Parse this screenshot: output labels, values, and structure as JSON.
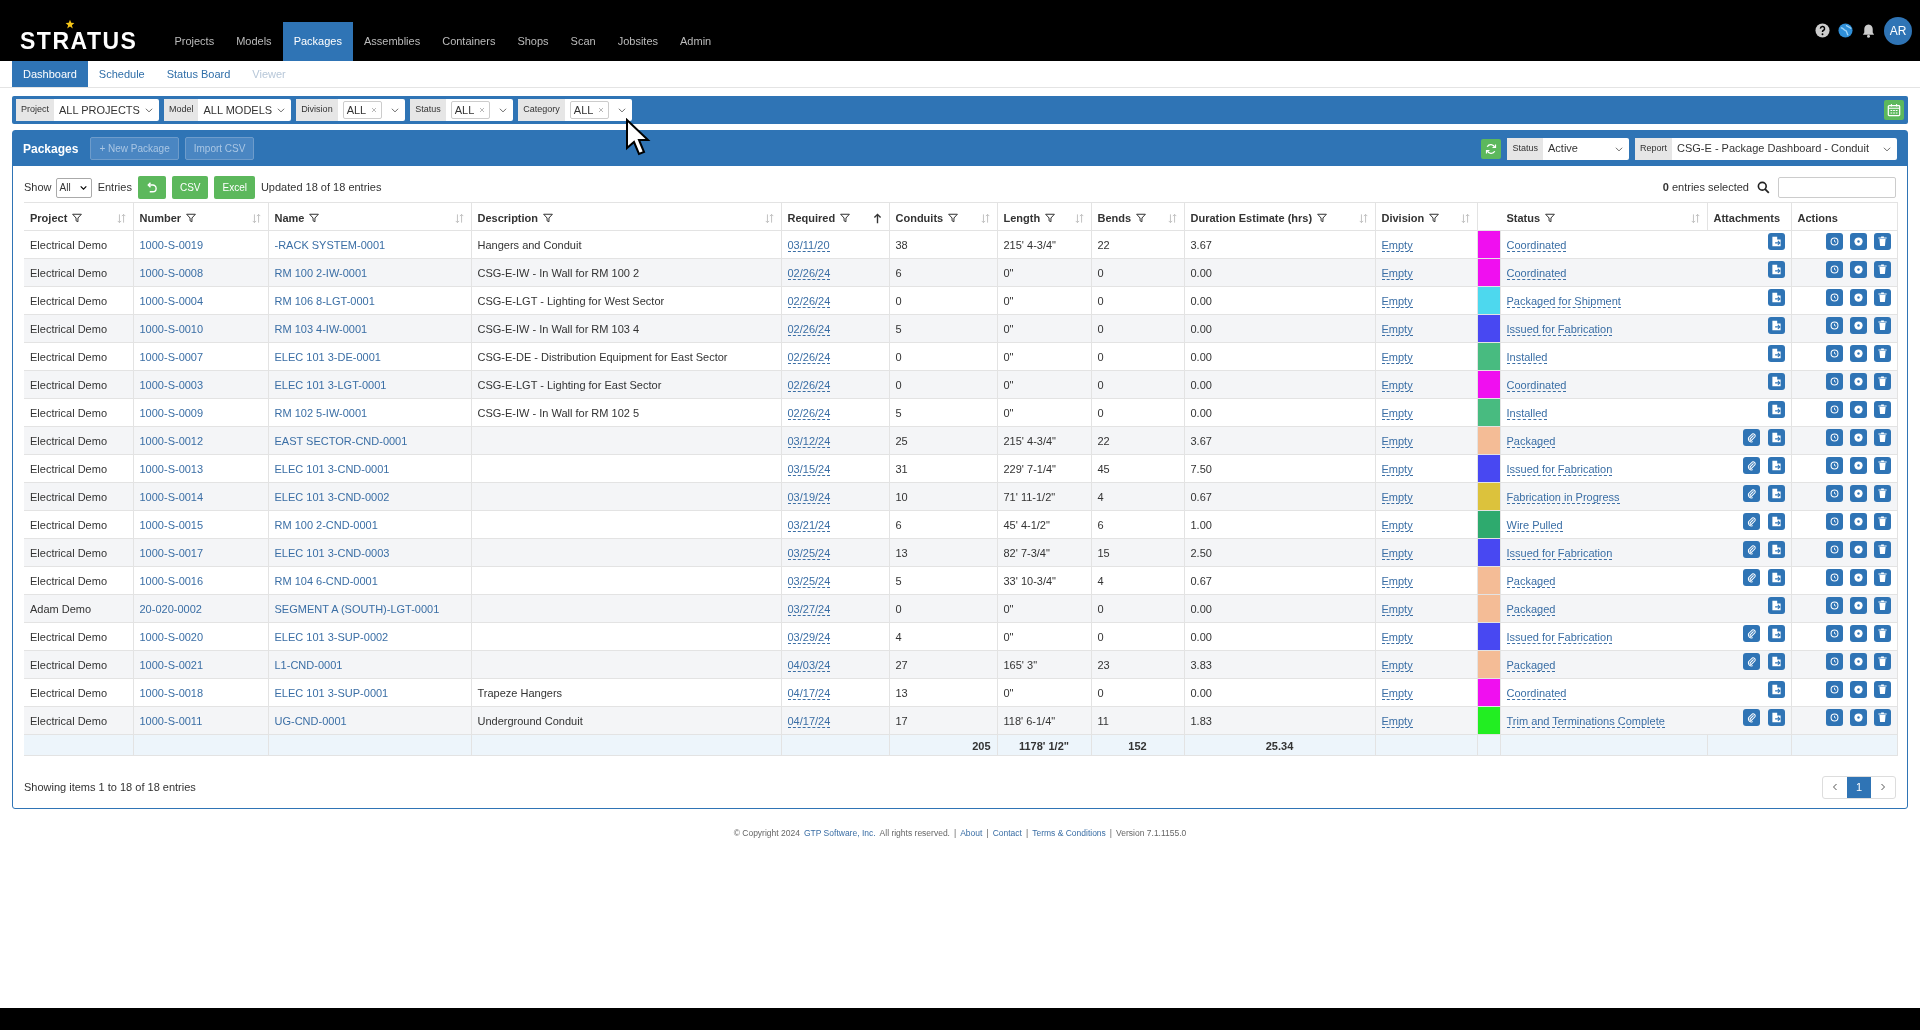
{
  "logo": "STRATUS",
  "nav": [
    {
      "label": "Projects",
      "selected": false
    },
    {
      "label": "Models",
      "selected": false
    },
    {
      "label": "Packages",
      "selected": true
    },
    {
      "label": "Assemblies",
      "selected": false
    },
    {
      "label": "Containers",
      "selected": false
    },
    {
      "label": "Shops",
      "selected": false
    },
    {
      "label": "Scan",
      "selected": false
    },
    {
      "label": "Jobsites",
      "selected": false
    },
    {
      "label": "Admin",
      "selected": false
    }
  ],
  "user": {
    "initials": "AR"
  },
  "subnav": [
    {
      "label": "Dashboard",
      "selected": true,
      "disabled": false
    },
    {
      "label": "Schedule",
      "selected": false,
      "disabled": false
    },
    {
      "label": "Status Board",
      "selected": false,
      "disabled": false
    },
    {
      "label": "Viewer",
      "selected": false,
      "disabled": true
    }
  ],
  "filters": [
    {
      "label": "Project",
      "value": "ALL PROJECTS",
      "clearable": false
    },
    {
      "label": "Model",
      "value": "ALL MODELS",
      "clearable": false
    },
    {
      "label": "Division",
      "value": "ALL",
      "clearable": true
    },
    {
      "label": "Status",
      "value": "ALL",
      "clearable": true
    },
    {
      "label": "Category",
      "value": "ALL",
      "clearable": true
    }
  ],
  "panel": {
    "title": "Packages",
    "buttons": [
      "+ New Package",
      "Import CSV"
    ],
    "status_filter": {
      "label": "Status",
      "value": "Active"
    },
    "report": {
      "label": "Report",
      "value": "CSG-E - Package Dashboard - Conduit"
    }
  },
  "toolbar": {
    "show_label": "Show",
    "show_value": "All",
    "entries_label": "Entries",
    "export_buttons": [
      "CSV",
      "Excel"
    ],
    "updated": "Updated 18 of 18 entries",
    "selected_count": "0",
    "selected_label": "entries selected"
  },
  "table": {
    "columns": [
      {
        "label": "Project",
        "filter": true,
        "sorted_ascending": false
      },
      {
        "label": "Number",
        "filter": true,
        "sorted_ascending": false
      },
      {
        "label": "Name",
        "filter": true,
        "sorted_ascending": false
      },
      {
        "label": "Description",
        "filter": true,
        "sorted_ascending": false
      },
      {
        "label": "Required",
        "filter": true,
        "sorted_ascending": true
      },
      {
        "label": "Conduits",
        "filter": true,
        "sorted_ascending": false
      },
      {
        "label": "Length",
        "filter": true,
        "sorted_ascending": false
      },
      {
        "label": "Bends",
        "filter": true,
        "sorted_ascending": false
      },
      {
        "label": "Duration Estimate (hrs)",
        "filter": true,
        "sorted_ascending": false
      },
      {
        "label": "Division",
        "filter": true,
        "sorted_ascending": false
      },
      {
        "label": "Status",
        "filter": true,
        "sorted_ascending": false
      },
      {
        "label": "Attachments",
        "filter": false
      },
      {
        "label": "Actions",
        "filter": false
      }
    ],
    "rows": [
      {
        "project": "Electrical Demo",
        "number": "1000-S-0019",
        "name": "-RACK SYSTEM-0001",
        "description": "Hangers and Conduit",
        "required": "03/11/20",
        "conduits": "38",
        "length": "215' 4-3/4\"",
        "bends": "22",
        "duration": "3.67",
        "division": "Empty",
        "color": "#f00ff0",
        "status": "Coordinated",
        "clip": false
      },
      {
        "project": "Electrical Demo",
        "number": "1000-S-0008",
        "name": "RM 100 2-IW-0001",
        "description": "CSG-E-IW - In Wall for RM 100 2",
        "required": "02/26/24",
        "conduits": "6",
        "length": "0\"",
        "bends": "0",
        "duration": "0.00",
        "division": "Empty",
        "color": "#f00ff0",
        "status": "Coordinated",
        "clip": false
      },
      {
        "project": "Electrical Demo",
        "number": "1000-S-0004",
        "name": "RM 106 8-LGT-0001",
        "description": "CSG-E-LGT - Lighting for West Sector",
        "required": "02/26/24",
        "conduits": "0",
        "length": "0\"",
        "bends": "0",
        "duration": "0.00",
        "division": "Empty",
        "color": "#4dd8ee",
        "status": "Packaged for Shipment",
        "clip": false
      },
      {
        "project": "Electrical Demo",
        "number": "1000-S-0010",
        "name": "RM 103 4-IW-0001",
        "description": "CSG-E-IW - In Wall for RM 103 4",
        "required": "02/26/24",
        "conduits": "5",
        "length": "0\"",
        "bends": "0",
        "duration": "0.00",
        "division": "Empty",
        "color": "#4848f2",
        "status": "Issued for Fabrication",
        "clip": false
      },
      {
        "project": "Electrical Demo",
        "number": "1000-S-0007",
        "name": "ELEC 101 3-DE-0001",
        "description": "CSG-E-DE - Distribution Equipment for East Sector",
        "required": "02/26/24",
        "conduits": "0",
        "length": "0\"",
        "bends": "0",
        "duration": "0.00",
        "division": "Empty",
        "color": "#48bb80",
        "status": "Installed",
        "clip": false
      },
      {
        "project": "Electrical Demo",
        "number": "1000-S-0003",
        "name": "ELEC 101 3-LGT-0001",
        "description": "CSG-E-LGT - Lighting for East Sector",
        "required": "02/26/24",
        "conduits": "0",
        "length": "0\"",
        "bends": "0",
        "duration": "0.00",
        "division": "Empty",
        "color": "#f00ff0",
        "status": "Coordinated",
        "clip": false
      },
      {
        "project": "Electrical Demo",
        "number": "1000-S-0009",
        "name": "RM 102 5-IW-0001",
        "description": "CSG-E-IW - In Wall for RM 102 5",
        "required": "02/26/24",
        "conduits": "5",
        "length": "0\"",
        "bends": "0",
        "duration": "0.00",
        "division": "Empty",
        "color": "#48bb80",
        "status": "Installed",
        "clip": false
      },
      {
        "project": "Electrical Demo",
        "number": "1000-S-0012",
        "name": "EAST SECTOR-CND-0001",
        "description": "",
        "required": "03/12/24",
        "conduits": "25",
        "length": "215' 4-3/4\"",
        "bends": "22",
        "duration": "3.67",
        "division": "Empty",
        "color": "#f4bc96",
        "status": "Packaged",
        "clip": true
      },
      {
        "project": "Electrical Demo",
        "number": "1000-S-0013",
        "name": "ELEC 101 3-CND-0001",
        "description": "",
        "required": "03/15/24",
        "conduits": "31",
        "length": "229' 7-1/4\"",
        "bends": "45",
        "duration": "7.50",
        "division": "Empty",
        "color": "#4848f2",
        "status": "Issued for Fabrication",
        "clip": true
      },
      {
        "project": "Electrical Demo",
        "number": "1000-S-0014",
        "name": "ELEC 101 3-CND-0002",
        "description": "",
        "required": "03/19/24",
        "conduits": "10",
        "length": "71' 11-1/2\"",
        "bends": "4",
        "duration": "0.67",
        "division": "Empty",
        "color": "#dcc23c",
        "status": "Fabrication in Progress",
        "clip": true
      },
      {
        "project": "Electrical Demo",
        "number": "1000-S-0015",
        "name": "RM 100 2-CND-0001",
        "description": "",
        "required": "03/21/24",
        "conduits": "6",
        "length": "45' 4-1/2\"",
        "bends": "6",
        "duration": "1.00",
        "division": "Empty",
        "color": "#2eaa6e",
        "status": "Wire Pulled",
        "clip": true
      },
      {
        "project": "Electrical Demo",
        "number": "1000-S-0017",
        "name": "ELEC 101 3-CND-0003",
        "description": "",
        "required": "03/25/24",
        "conduits": "13",
        "length": "82' 7-3/4\"",
        "bends": "15",
        "duration": "2.50",
        "division": "Empty",
        "color": "#4848f2",
        "status": "Issued for Fabrication",
        "clip": true
      },
      {
        "project": "Electrical Demo",
        "number": "1000-S-0016",
        "name": "RM 104 6-CND-0001",
        "description": "",
        "required": "03/25/24",
        "conduits": "5",
        "length": "33' 10-3/4\"",
        "bends": "4",
        "duration": "0.67",
        "division": "Empty",
        "color": "#f4bc96",
        "status": "Packaged",
        "clip": true
      },
      {
        "project": "Adam Demo",
        "number": "20-020-0002",
        "name": "SEGMENT A (SOUTH)-LGT-0001",
        "description": "",
        "required": "03/27/24",
        "conduits": "0",
        "length": "0\"",
        "bends": "0",
        "duration": "0.00",
        "division": "Empty",
        "color": "#f4bc96",
        "status": "Packaged",
        "clip": false
      },
      {
        "project": "Electrical Demo",
        "number": "1000-S-0020",
        "name": "ELEC 101 3-SUP-0002",
        "description": "",
        "required": "03/29/24",
        "conduits": "4",
        "length": "0\"",
        "bends": "0",
        "duration": "0.00",
        "division": "Empty",
        "color": "#4848f2",
        "status": "Issued for Fabrication",
        "clip": true
      },
      {
        "project": "Electrical Demo",
        "number": "1000-S-0021",
        "name": "L1-CND-0001",
        "description": "",
        "required": "04/03/24",
        "conduits": "27",
        "length": "165' 3\"",
        "bends": "23",
        "duration": "3.83",
        "division": "Empty",
        "color": "#f4bc96",
        "status": "Packaged",
        "clip": true
      },
      {
        "project": "Electrical Demo",
        "number": "1000-S-0018",
        "name": "ELEC 101 3-SUP-0001",
        "description": "Trapeze Hangers",
        "required": "04/17/24",
        "conduits": "13",
        "length": "0\"",
        "bends": "0",
        "duration": "0.00",
        "division": "Empty",
        "color": "#f00ff0",
        "status": "Coordinated",
        "clip": false
      },
      {
        "project": "Electrical Demo",
        "number": "1000-S-0011",
        "name": "UG-CND-0001",
        "description": "Underground Conduit",
        "required": "04/17/24",
        "conduits": "17",
        "length": "118' 6-1/4\"",
        "bends": "11",
        "duration": "1.83",
        "division": "Empty",
        "color": "#22ee22",
        "status": "Trim and Terminations Complete",
        "clip": true
      }
    ],
    "totals": {
      "conduits": "205",
      "length": "1178' 1/2\"",
      "bends": "152",
      "duration": "25.34"
    }
  },
  "showing": "Showing items 1 to 18 of 18 entries",
  "pagination": {
    "pages": [
      {
        "label": "1",
        "selected": true
      }
    ]
  },
  "footer": [
    {
      "kind": "text",
      "text": "© Copyright 2024"
    },
    {
      "kind": "link",
      "text": "GTP Software, Inc."
    },
    {
      "kind": "text",
      "text": "All rights reserved."
    },
    {
      "kind": "sep",
      "text": "|"
    },
    {
      "kind": "link",
      "text": "About"
    },
    {
      "kind": "sep",
      "text": "|"
    },
    {
      "kind": "link",
      "text": "Contact"
    },
    {
      "kind": "sep",
      "text": "|"
    },
    {
      "kind": "link",
      "text": "Terms & Conditions"
    },
    {
      "kind": "sep",
      "text": "|"
    },
    {
      "kind": "text",
      "text": "Version 7.1.1155.0"
    }
  ]
}
